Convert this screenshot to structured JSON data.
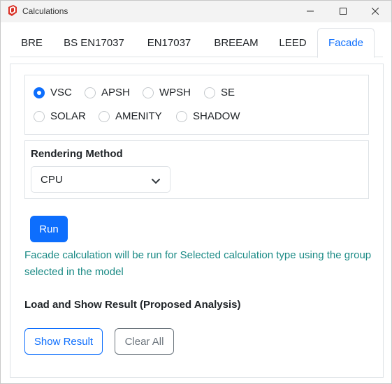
{
  "window": {
    "title": "Calculations"
  },
  "tabs": [
    {
      "label": "BRE"
    },
    {
      "label": "BS EN17037"
    },
    {
      "label": "EN17037"
    },
    {
      "label": "BREEAM"
    },
    {
      "label": "LEED"
    },
    {
      "label": "Facade",
      "active": true
    }
  ],
  "calculation_types": [
    {
      "label": "VSC",
      "checked": true
    },
    {
      "label": "APSH",
      "checked": false
    },
    {
      "label": "WPSH",
      "checked": false
    },
    {
      "label": "SE",
      "checked": false
    },
    {
      "label": "SOLAR",
      "checked": false
    },
    {
      "label": "AMENITY",
      "checked": false
    },
    {
      "label": "SHADOW",
      "checked": false
    }
  ],
  "rendering": {
    "label": "Rendering Method",
    "selected": "CPU"
  },
  "run_label": "Run",
  "info_text": "Facade calculation will be run for Selected calculation type using the group selected in the model",
  "results": {
    "heading": "Load and Show Result (Proposed Analysis)",
    "show_label": "Show Result",
    "clear_label": "Clear All"
  },
  "colors": {
    "primary": "#0d6efd",
    "info_text": "#1a8a85",
    "secondary": "#6c757d",
    "app_icon": "#d93025"
  },
  "icons": {
    "app": "sketchup-logo-icon",
    "minimize": "minimize-icon",
    "maximize": "maximize-icon",
    "close": "close-icon",
    "dropdown": "chevron-down-icon"
  }
}
